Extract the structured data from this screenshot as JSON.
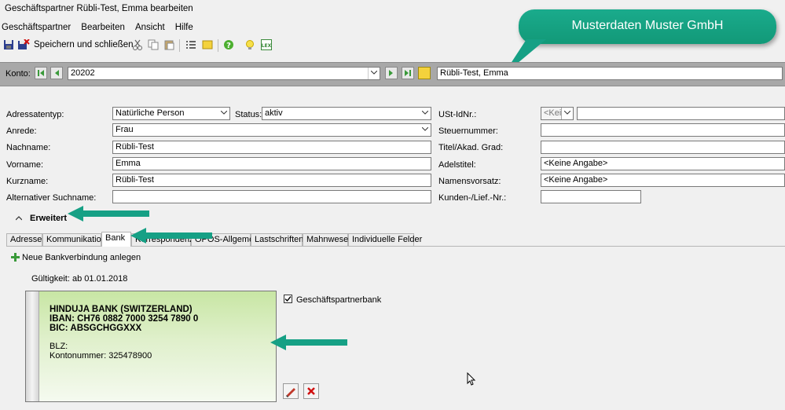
{
  "window": {
    "title": "Geschäftspartner Rübli-Test, Emma bearbeiten"
  },
  "menu": [
    "Geschäftspartner",
    "Bearbeiten",
    "Ansicht",
    "Hilfe"
  ],
  "toolbar": {
    "save_label": "Speichern und schließen"
  },
  "callout": {
    "text": "Musterdaten Muster GmbH"
  },
  "konto": {
    "label": "Konto:",
    "value": "20202",
    "name": "Rübli-Test, Emma"
  },
  "form": {
    "adressatentyp_label": "Adressatentyp:",
    "adressatentyp_value": "Natürliche Person",
    "status_label": "Status:",
    "status_value": "aktiv",
    "anrede_label": "Anrede:",
    "anrede_value": "Frau",
    "nachname_label": "Nachname:",
    "nachname_value": "Rübli-Test",
    "vorname_label": "Vorname:",
    "vorname_value": "Emma",
    "kurzname_label": "Kurzname:",
    "kurzname_value": "Rübli-Test",
    "altsuch_label": "Alternativer Suchname:",
    "altsuch_value": "",
    "ust_label": "USt-IdNr.:",
    "ust_country": "<Keir",
    "ust_value": "",
    "steuer_label": "Steuernummer:",
    "steuer_value": "",
    "titel_label": "Titel/Akad. Grad:",
    "titel_value": "",
    "adel_label": "Adelstitel:",
    "adel_value": "<Keine Angabe>",
    "namensvorsatz_label": "Namensvorsatz:",
    "namensvorsatz_value": "<Keine Angabe>",
    "kunden_label": "Kunden-/Lief.-Nr.:",
    "kunden_value": ""
  },
  "erweitert": {
    "label": "Erweitert"
  },
  "tabs": [
    "Adresse",
    "Kommunikation",
    "Bank",
    "Korrespondenz",
    "OPOS-Allgemein",
    "Lastschriften",
    "Mahnwesen",
    "Individuelle Felder"
  ],
  "bank": {
    "new_label": "Neue Bankverbindung anlegen",
    "gueltig_label": "Gültigkeit:",
    "gueltig_value": "ab 01.01.2018",
    "name": "HINDUJA BANK (SWITZERLAND)",
    "iban": "IBAN:  CH76 0882 7000 3254 7890 0",
    "bic": "BIC:  ABSGCHGGXXX",
    "blz": "BLZ:",
    "konto": "Kontonummer:  325478900",
    "partnerbank_label": "Geschäftspartnerbank"
  },
  "colors": {
    "accent": "#16a085",
    "konto_bar": "#a8a8a8",
    "card_green": "#c8e6a4"
  }
}
